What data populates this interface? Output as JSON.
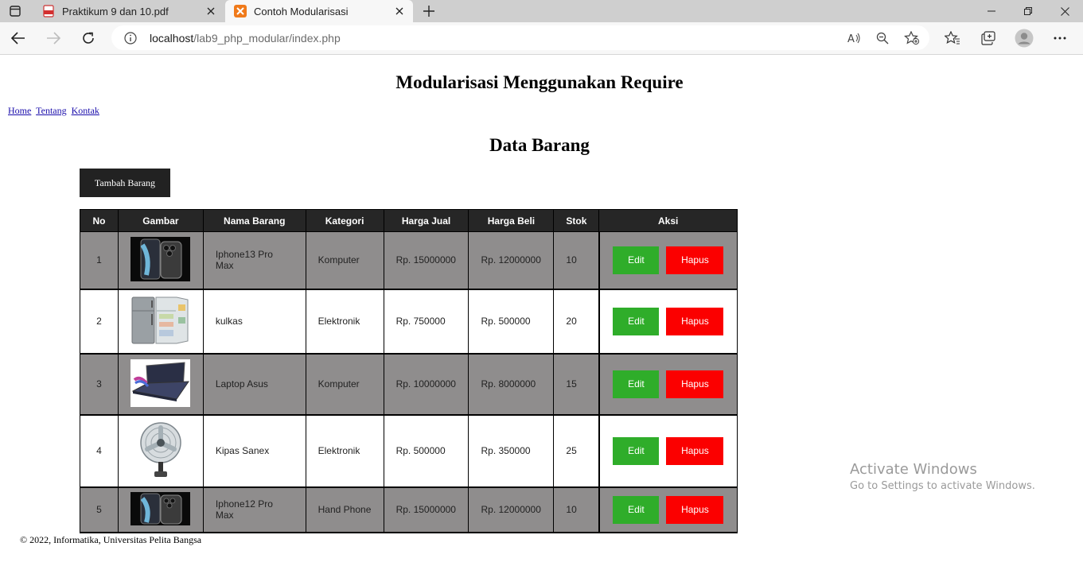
{
  "browser": {
    "tabs": [
      {
        "title": "Praktikum 9 dan 10.pdf",
        "icon": "pdf-icon"
      },
      {
        "title": "Contoh Modularisasi",
        "icon": "xampp-icon"
      }
    ],
    "url_host": "localhost",
    "url_path": "/lab9_php_modular/index.php"
  },
  "page": {
    "site_title": "Modularisasi Menggunakan Require",
    "nav": [
      "Home",
      "Tentang",
      "Kontak"
    ],
    "section_title": "Data Barang",
    "add_button": "Tambah Barang",
    "table": {
      "headers": [
        "No",
        "Gambar",
        "Nama Barang",
        "Kategori",
        "Harga Jual",
        "Harga Beli",
        "Stok",
        "Aksi"
      ],
      "rows": [
        {
          "no": "1",
          "image": "iphone-image",
          "nama": "Iphone13 Pro Max",
          "kategori": "Komputer",
          "harga_jual": "Rp. 15000000",
          "harga_beli": "Rp. 12000000",
          "stok": "10"
        },
        {
          "no": "2",
          "image": "fridge-image",
          "nama": "kulkas",
          "kategori": "Elektronik",
          "harga_jual": "Rp. 750000",
          "harga_beli": "Rp. 500000",
          "stok": "20"
        },
        {
          "no": "3",
          "image": "laptop-image",
          "nama": "Laptop Asus",
          "kategori": "Komputer",
          "harga_jual": "Rp. 10000000",
          "harga_beli": "Rp. 8000000",
          "stok": "15"
        },
        {
          "no": "4",
          "image": "fan-image",
          "nama": "Kipas Sanex",
          "kategori": "Elektronik",
          "harga_jual": "Rp. 500000",
          "harga_beli": "Rp. 350000",
          "stok": "25"
        },
        {
          "no": "5",
          "image": "iphone-image",
          "nama": "Iphone12 Pro Max",
          "kategori": "Hand Phone",
          "harga_jual": "Rp. 15000000",
          "harga_beli": "Rp. 12000000",
          "stok": "10"
        }
      ],
      "edit_label": "Edit",
      "delete_label": "Hapus"
    },
    "footer": "© 2022, Informatika, Universitas Pelita Bangsa"
  },
  "os_watermark": {
    "line1": "Activate Windows",
    "line2": "Go to Settings to activate Windows."
  },
  "colors": {
    "edit": "#2fad2a",
    "delete": "#fb0000",
    "header": "#262626",
    "odd_row": "#8f8d8d"
  }
}
